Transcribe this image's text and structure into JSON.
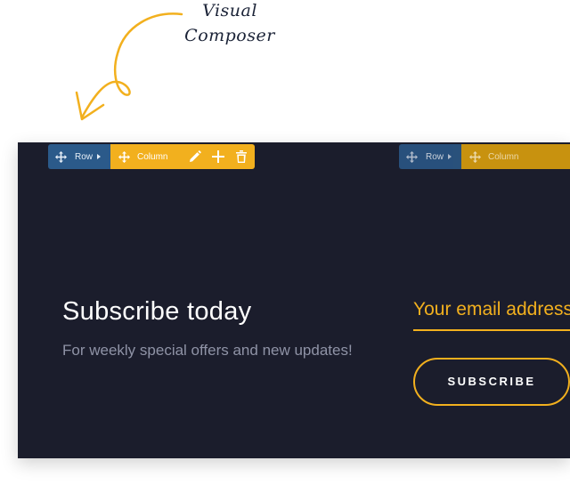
{
  "annotation": {
    "label_line1": "Visual",
    "label_line2": "Composer",
    "color": "#f2b01e"
  },
  "toolbar_left": {
    "row_label": "Row",
    "column_label": "Column",
    "icons": [
      "move-icon",
      "caret-right-icon",
      "move-icon",
      "pencil-icon",
      "plus-icon",
      "trash-icon"
    ]
  },
  "toolbar_right": {
    "row_label": "Row",
    "column_label": "Column",
    "icons": [
      "move-icon",
      "caret-right-icon",
      "move-icon",
      "pencil-icon"
    ]
  },
  "subscribe": {
    "heading": "Subscribe today",
    "subtext": "For weekly special offers and new updates!",
    "email_placeholder": "Your email address",
    "button_label": "SUBSCRIBE"
  },
  "colors": {
    "background": "#1b1d2c",
    "accent": "#f2b01e",
    "row_toolbar": "#2b5a8a",
    "heading_text": "#ffffff",
    "subtext": "#8f93a6"
  }
}
